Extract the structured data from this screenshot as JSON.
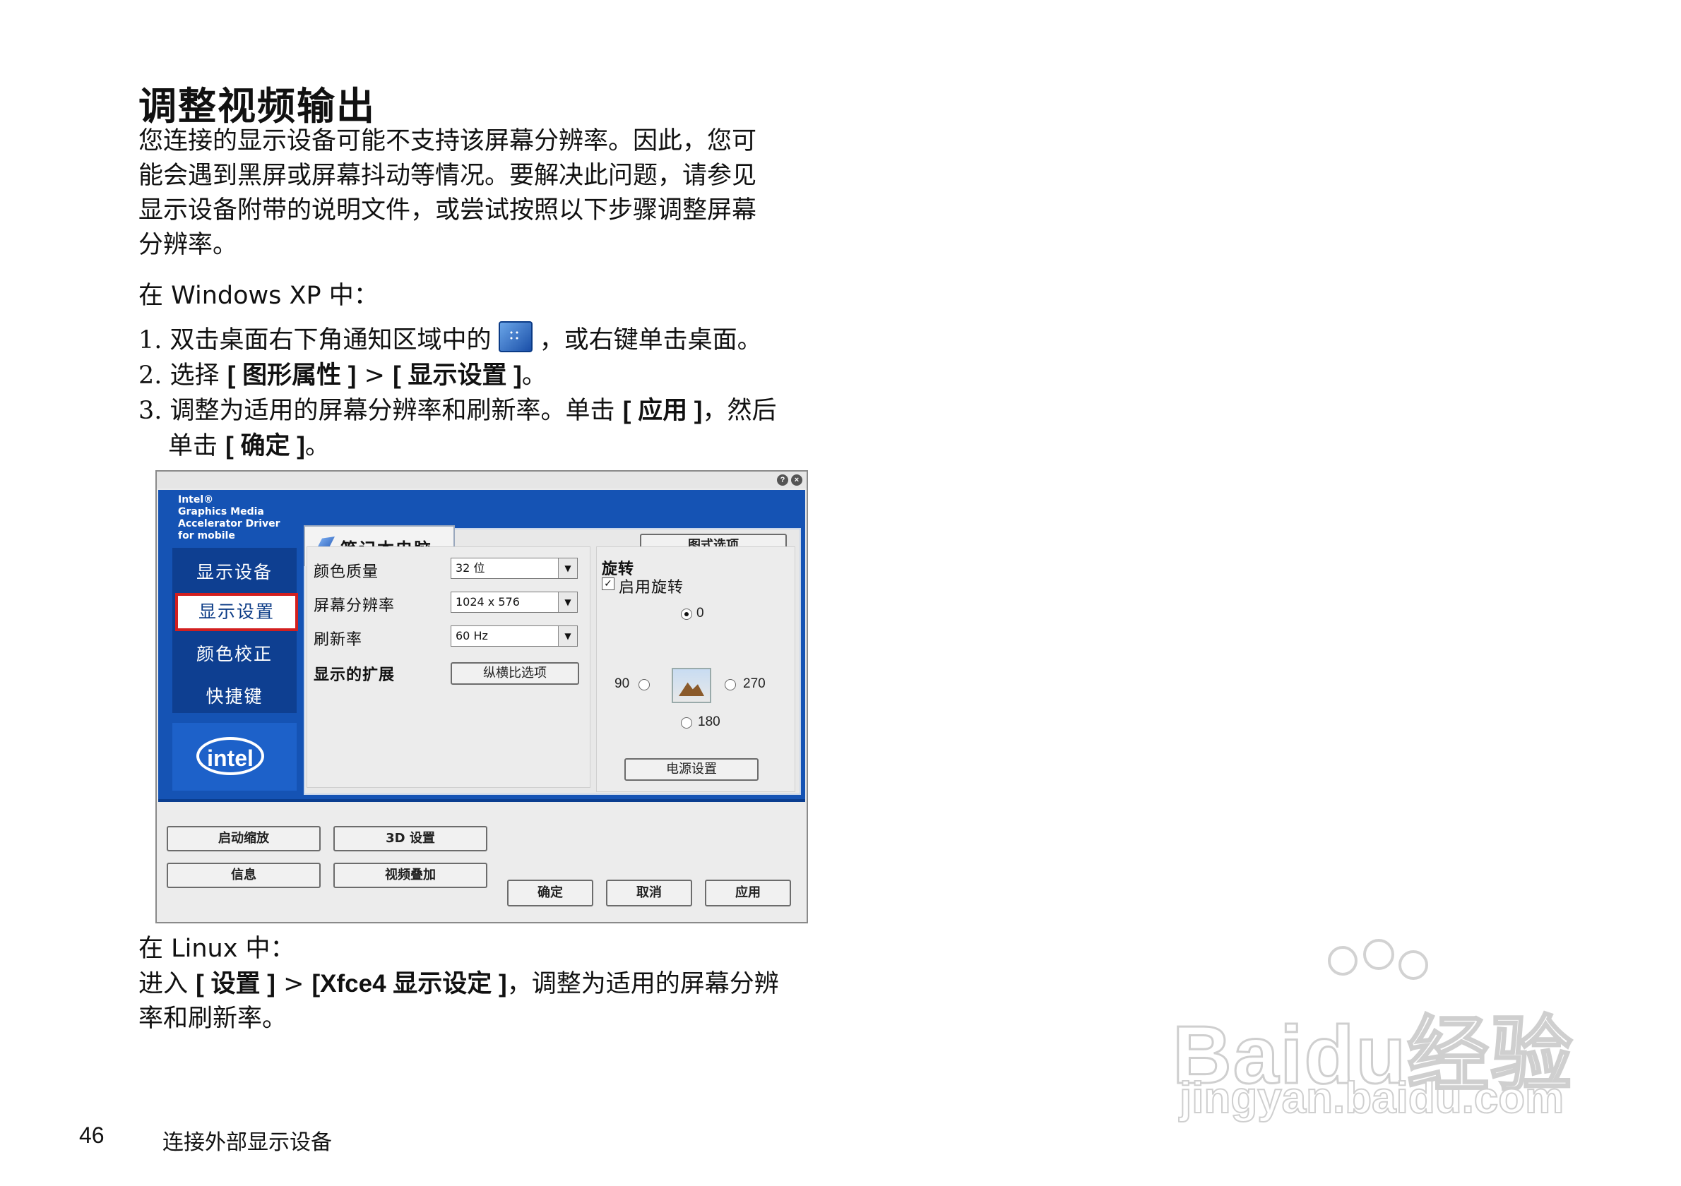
{
  "heading": "调整视频输出",
  "intro": [
    "您连接的显示设备可能不支持该屏幕分辨率。因此，您可",
    "能会遇到黑屏或屏幕抖动等情况。要解决此问题，请参见",
    "显示设备附带的说明文件，或尝试按照以下步骤调整屏幕",
    "分辨率。"
  ],
  "windows_heading": "在 Windows XP 中：",
  "steps": {
    "s1_num": "1.",
    "s1_a": "双击桌面右下角通知区域中的",
    "s1_b": "，或右键单击桌面。",
    "s2_num": "2.",
    "s2_a": "选择",
    "s2_m1": "[ 图形属性 ]",
    "s2_sep": ">",
    "s2_m2": "[ 显示设置 ]",
    "s2_end": "。",
    "s3_num": "3.",
    "s3_a": "调整为适用的屏幕分辨率和刷新率。单击",
    "s3_m1": "[ 应用 ]",
    "s3_b": "，然后",
    "s3_c": "单击",
    "s3_m2": "[ 确定 ]",
    "s3_end": "。"
  },
  "screenshot": {
    "brand": [
      "Intel®",
      "Graphics Media",
      "Accelerator Driver",
      "for mobile"
    ],
    "nav": [
      "显示设备",
      "显示设置",
      "颜色校正",
      "快捷键"
    ],
    "nav_active_index": 1,
    "tab": "笔记本电脑",
    "scheme_button": "图式选项",
    "fields": {
      "color_label": "颜色质量",
      "color_value": "32 位",
      "resolution_label": "屏幕分辨率",
      "resolution_value": "1024 x 576",
      "refresh_label": "刷新率",
      "refresh_value": "60 Hz",
      "extend_label": "显示的扩展",
      "aspect_button": "纵横比选项"
    },
    "rotation": {
      "title": "旋转",
      "enable": "启用旋转",
      "opt_0": "0",
      "opt_90": "90",
      "opt_270": "270",
      "opt_180": "180",
      "selected": "0"
    },
    "power_button": "电源设置",
    "bottom_buttons": {
      "hotkeys": "启动缩放",
      "threed": "3D 设置",
      "info": "信息",
      "overlay": "视频叠加",
      "ok": "确定",
      "cancel": "取消",
      "apply": "应用"
    },
    "intel_logo": "intel"
  },
  "linux_heading": "在 Linux 中：",
  "linux": {
    "a": "进入",
    "m1": "[ 设置 ]",
    "sep": ">",
    "m2": "[Xfce4 显示设定 ]",
    "b": "，调整为适用的屏幕分辨",
    "c": "率和刷新率。"
  },
  "page_number": "46",
  "footer": "连接外部显示设备",
  "watermark": {
    "main": "Baidu经验",
    "url": "jingyan.baidu.com"
  }
}
